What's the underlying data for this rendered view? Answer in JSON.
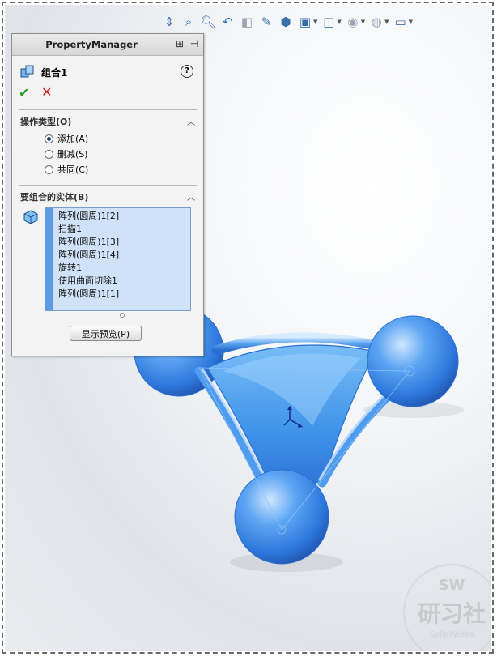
{
  "colors": {
    "model_blue": "#3f8ee8",
    "model_edge": "#2a6fd0",
    "selection_blue": "#cfe2f7",
    "ok_green": "#2c9a2c",
    "cancel_red": "#d21c1c"
  },
  "hud_toolbar": {
    "icons": [
      "view-orientation-icon",
      "zoom-to-fit-icon",
      "zoom-to-area-icon",
      "previous-view-icon",
      "section-view-icon",
      "dynamic-annotation-icon",
      "view-cube-icon",
      "display-style-icon",
      "hide-show-items-icon",
      "edit-appearance-icon",
      "apply-scene-icon",
      "view-settings-icon"
    ]
  },
  "property_manager": {
    "title": "PropertyManager",
    "feature": {
      "name": "组合1",
      "icon": "combine-feature-icon"
    },
    "operation_type": {
      "title": "操作类型(O)",
      "options": [
        {
          "label": "添加(A)",
          "checked": true
        },
        {
          "label": "删减(S)",
          "checked": false
        },
        {
          "label": "共同(C)",
          "checked": false
        }
      ]
    },
    "bodies": {
      "title": "要组合的实体(B)",
      "items": [
        "阵列(圆周)1[2]",
        "扫描1",
        "阵列(圆周)1[3]",
        "阵列(圆周)1[4]",
        "旋转1",
        "使用曲面切除1",
        "阵列(圆周)1[1]"
      ]
    },
    "preview_button": "显示预览(P)"
  },
  "watermark": {
    "top": "SW",
    "main": "研习社",
    "sub": "SolidWorks"
  }
}
